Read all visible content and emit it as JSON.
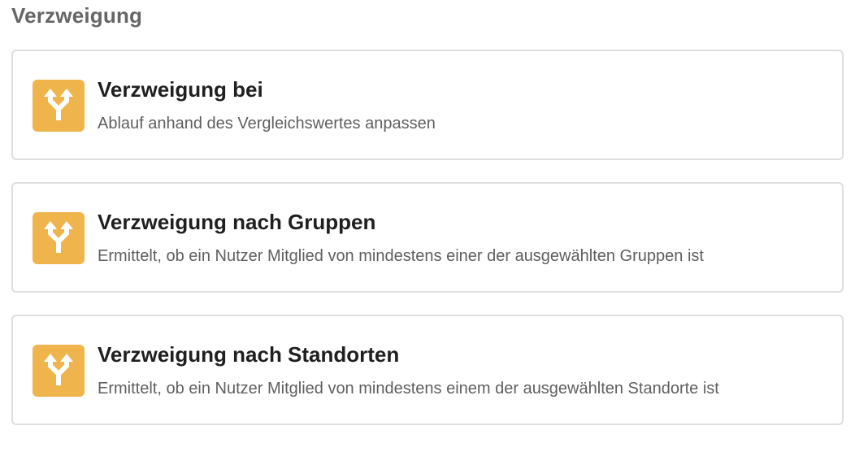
{
  "section": {
    "title": "Verzweigung"
  },
  "cards": [
    {
      "icon": "branch-split-icon",
      "title": "Verzweigung bei",
      "description": "Ablauf anhand des Vergleichswertes anpassen"
    },
    {
      "icon": "branch-split-icon",
      "title": "Verzweigung nach Gruppen",
      "description": "Ermittelt, ob ein Nutzer Mitglied von mindestens einer der ausgewählten Gruppen ist"
    },
    {
      "icon": "branch-split-icon",
      "title": "Verzweigung nach Standorten",
      "description": "Ermittelt, ob ein Nutzer Mitglied von mindestens einem der ausgewählten Standorte ist"
    }
  ],
  "colors": {
    "icon_background": "#f0b44c",
    "icon_foreground": "#ffffff",
    "card_border": "#dedede",
    "title_text": "#1f1f1f",
    "description_text": "#5f5f5f",
    "section_title_text": "#666666"
  }
}
